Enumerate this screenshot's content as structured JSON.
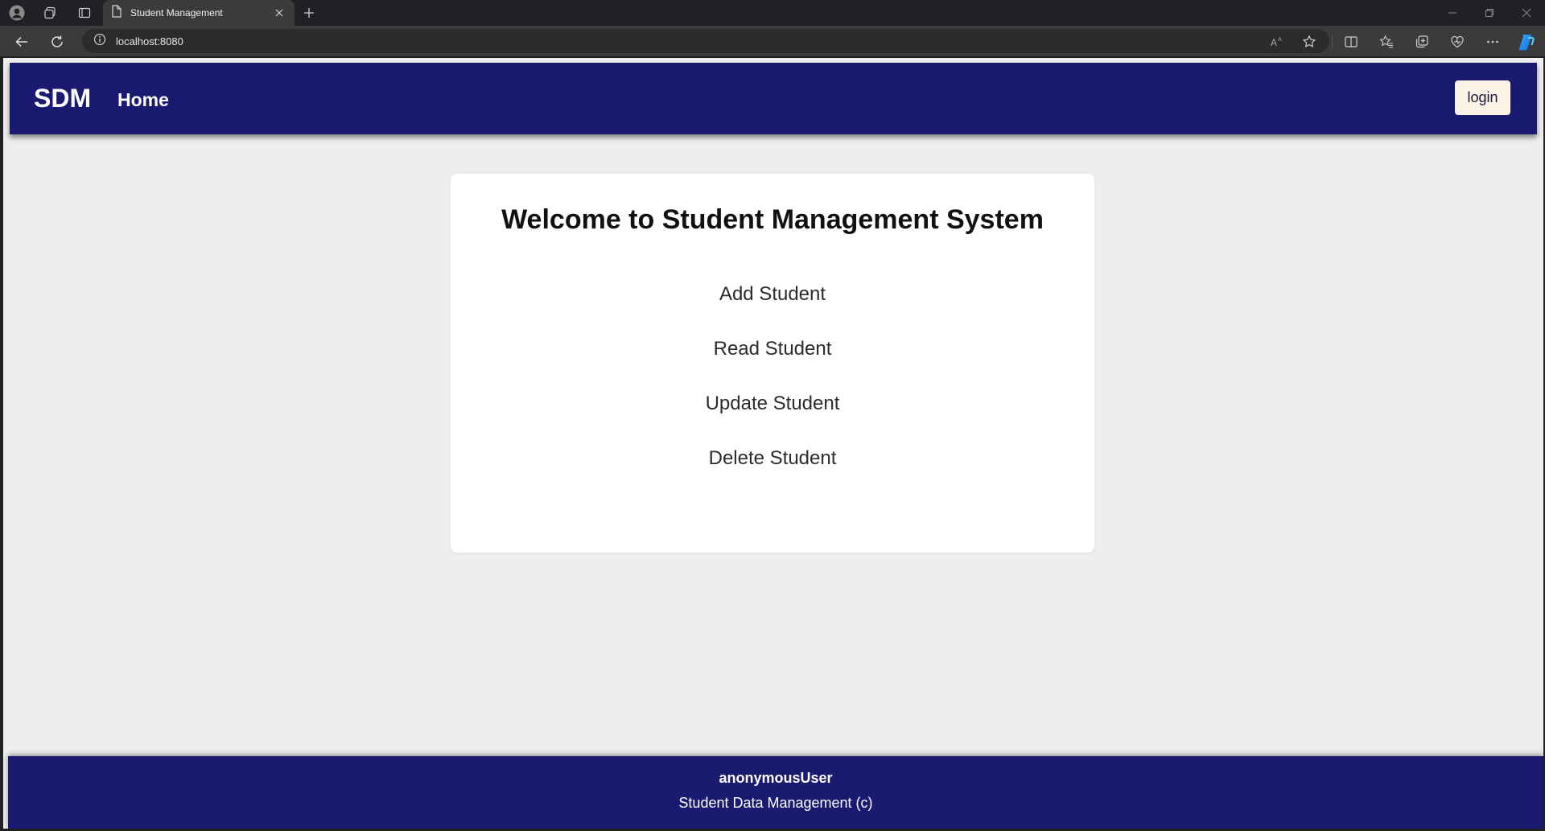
{
  "browser": {
    "tab_title": "Student Management",
    "url": "localhost:8080"
  },
  "header": {
    "brand": "SDM",
    "nav_home": "Home",
    "login_label": "login",
    "bg_color": "#1a1a70",
    "login_bg": "#fdf3e7"
  },
  "main": {
    "title": "Welcome to Student Management System",
    "links": [
      {
        "label": "Add Student"
      },
      {
        "label": "Read Student"
      },
      {
        "label": "Update Student"
      },
      {
        "label": "Delete Student"
      }
    ]
  },
  "footer": {
    "user": "anonymousUser",
    "copyright": "Student Data Management (c)"
  },
  "icons": [
    "profile-icon",
    "workspaces-icon",
    "tab-actions-icon",
    "page-icon",
    "close-icon",
    "plus-icon",
    "back-icon",
    "refresh-icon",
    "info-icon",
    "read-aloud-icon",
    "favorite-star-icon",
    "split-screen-icon",
    "favorites-icon",
    "collections-icon",
    "browser-essentials-icon",
    "more-icon",
    "copilot-icon",
    "minimize-icon",
    "restore-icon",
    "window-close-icon"
  ]
}
